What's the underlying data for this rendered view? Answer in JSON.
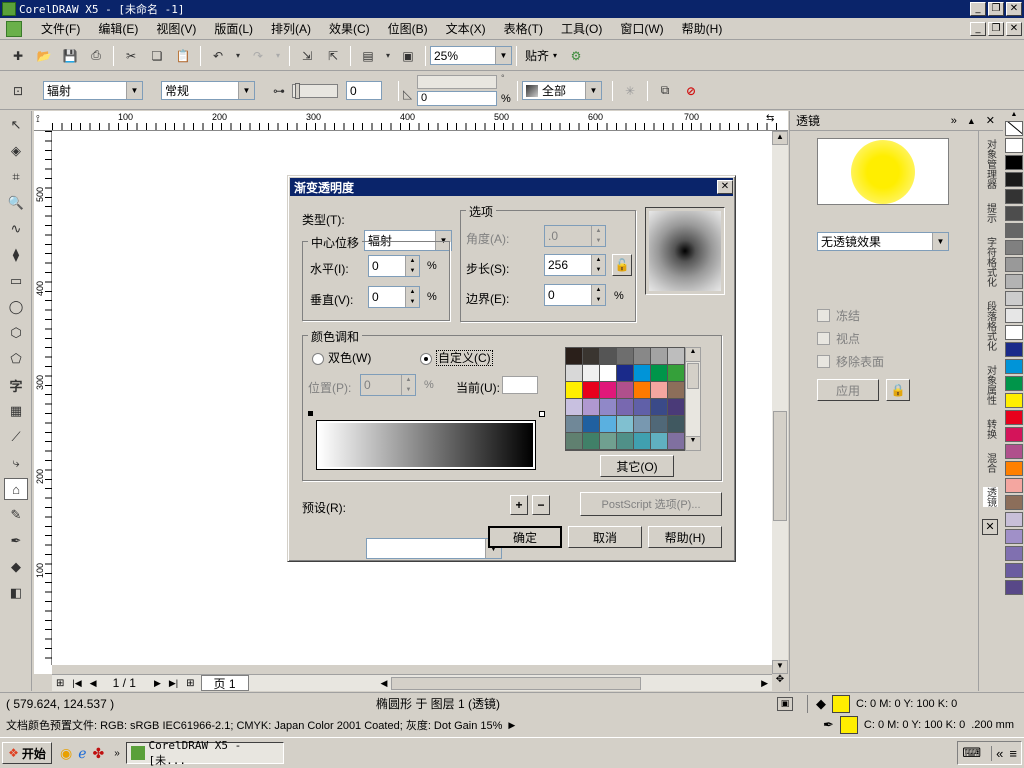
{
  "window": {
    "title": "CorelDRAW X5 - [未命名 -1]"
  },
  "menu": [
    "文件(F)",
    "编辑(E)",
    "视图(V)",
    "版面(L)",
    "排列(A)",
    "效果(C)",
    "位图(B)",
    "文本(X)",
    "表格(T)",
    "工具(O)",
    "窗口(W)",
    "帮助(H)"
  ],
  "toolbar1": {
    "zoom": "25%",
    "snap_label": "贴齐"
  },
  "toolbar2": {
    "fill_type": "辐射",
    "mode": "常规",
    "midpoint_value": "0",
    "angle_value": "0",
    "pct_symbol": "%",
    "target": "全部"
  },
  "rulers": {
    "h_labels": [
      "100",
      "200",
      "300",
      "400",
      "500",
      "600",
      "700"
    ],
    "v_labels": [
      "500",
      "400",
      "300",
      "200",
      "100"
    ]
  },
  "docker": {
    "title": "透镜",
    "lens_select": "无透镜效果",
    "freeze": "冻结",
    "viewpoint": "视点",
    "remove_face": "移除表面",
    "apply": "应用",
    "tabs": [
      "对象管理器",
      "提示",
      "字符格式化",
      "段落格式化",
      "对象属性",
      "转换",
      "混合",
      "透镜"
    ]
  },
  "palette": [
    "#ffffff",
    "#000000",
    "#1a1a1a",
    "#333333",
    "#4d4d4d",
    "#666666",
    "#808080",
    "#999999",
    "#b3b3b3",
    "#cccccc",
    "#e6e6e6",
    "#ffffff",
    "#1a2a8a",
    "#0094d8",
    "#00954a",
    "#ffee00",
    "#e8001c",
    "#d4145a",
    "#b0508c",
    "#ff8000",
    "#f4a6a0",
    "#8c6e5a",
    "#c8bfd8",
    "#a090c8",
    "#8070b0",
    "#6a5ca0",
    "#584888"
  ],
  "pagenav": {
    "count": "1 / 1",
    "page_tab": "页 1"
  },
  "status": {
    "coords": "( 579.624, 124.537 )",
    "object": "椭圆形 于 图层 1 (透镜)",
    "fill_cmyk": "C: 0 M: 0 Y: 100 K: 0",
    "outline_cmyk": "C: 0 M: 0 Y: 100 K: 0",
    "outline_width": ".200 mm",
    "color_profile": "文档颜色预置文件: RGB: sRGB IEC61966-2.1; CMYK: Japan Color 2001 Coated; 灰度: Dot Gain 15%"
  },
  "taskbar": {
    "start": "开始",
    "task": "CorelDRAW X5 - [未..."
  },
  "dialog": {
    "title": "渐变透明度",
    "type_label": "类型(T):",
    "type_value": "辐射",
    "center_group": "中心位移",
    "horizontal_label": "水平(I):",
    "horizontal_value": "0",
    "vertical_label": "垂直(V):",
    "vertical_value": "0",
    "pct": "%",
    "options_group": "选项",
    "angle_label": "角度(A):",
    "angle_value": ".0",
    "steps_label": "步长(S):",
    "steps_value": "256",
    "edge_label": "边界(E):",
    "edge_value": "0",
    "blend_group": "颜色调和",
    "two_color": "双色(W)",
    "custom": "自定义(C)",
    "position_label": "位置(P):",
    "position_value": "0",
    "current_label": "当前(U):",
    "others": "其它(O)",
    "presets_label": "预设(R):",
    "postscript": "PostScript 选项(P)...",
    "ok": "确定",
    "cancel": "取消",
    "help": "帮助(H)",
    "palette_colors": [
      "#2a1f1a",
      "#3a3530",
      "#555555",
      "#6e6e6e",
      "#888888",
      "#a3a3a3",
      "#bdbdbd",
      "#d8d8d8",
      "#f0f0f0",
      "#ffffff",
      "#1a2a8a",
      "#0094d8",
      "#00954a",
      "#35a03a",
      "#ffee00",
      "#e8001c",
      "#e0187a",
      "#b0508c",
      "#ff7a00",
      "#f4a6a0",
      "#8c6e5a",
      "#c8c0e0",
      "#b098d0",
      "#9088c8",
      "#7868b0",
      "#6060a8",
      "#3a4a88",
      "#4a3a78",
      "#708898",
      "#2060a0",
      "#5ab0e0",
      "#80c0d0",
      "#7898b0",
      "#506878",
      "#405860",
      "#608070",
      "#408068",
      "#70a090",
      "#509088",
      "#40a0b0",
      "#60b0c0",
      "#8070a0"
    ]
  }
}
